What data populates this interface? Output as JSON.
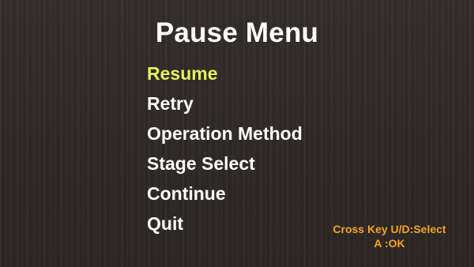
{
  "title": "Pause Menu",
  "menu": {
    "selected_index": 0,
    "items": [
      {
        "label": "Resume"
      },
      {
        "label": "Retry"
      },
      {
        "label": "Operation Method"
      },
      {
        "label": "Stage Select"
      },
      {
        "label": "Continue"
      },
      {
        "label": "Quit"
      }
    ]
  },
  "controls": {
    "line1": "Cross Key U/D:Select",
    "line2": "A :OK"
  },
  "colors": {
    "background": "#2e2826",
    "title": "#ffffff",
    "menu_item": "#ffffff",
    "menu_selected": "#e4f25c",
    "controls_hint": "#f3a524"
  }
}
